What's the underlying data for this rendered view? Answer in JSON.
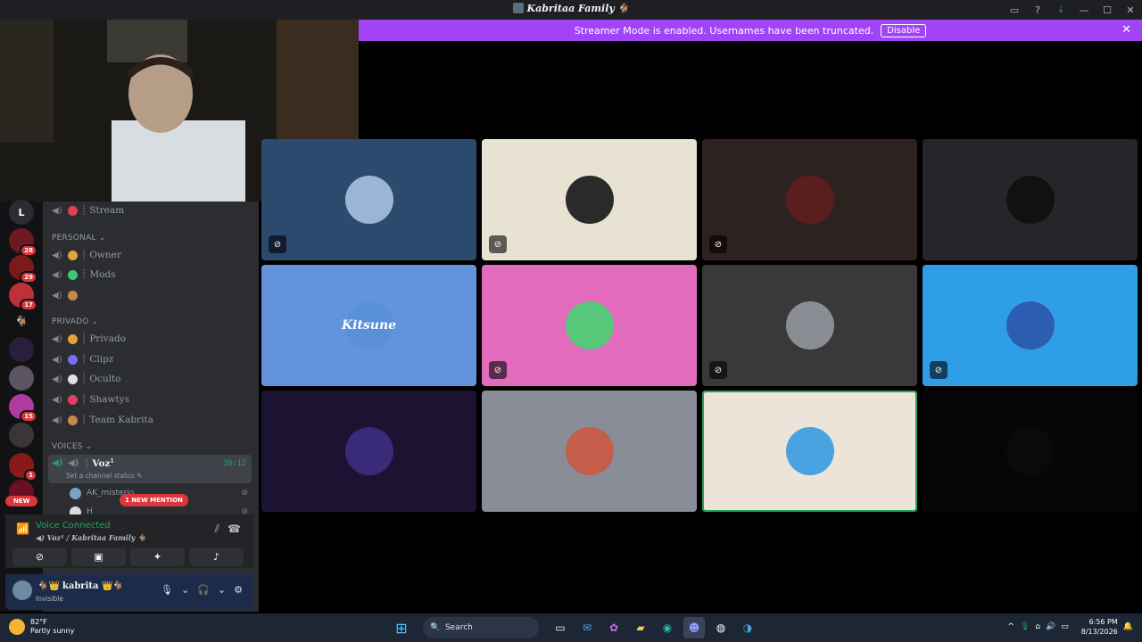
{
  "window": {
    "title": "Kabritaa Family",
    "title_emoji": "🐐"
  },
  "banner": {
    "message": "Streamer Mode is enabled. Usernames have been truncated.",
    "button": "Disable"
  },
  "rail": {
    "home_letter": "L",
    "badges": [
      "28",
      "29",
      "17",
      "15",
      "1"
    ],
    "new_label": "NEW"
  },
  "channels": {
    "top": [
      {
        "name": "Stream",
        "emoji_color": "#e0404f"
      }
    ],
    "personal": {
      "label": "PERSONAL",
      "items": [
        {
          "name": "Owner",
          "emoji_color": "#e3a33b"
        },
        {
          "name": "Mods",
          "emoji_color": "#3ec97a"
        },
        {
          "name": "",
          "emoji_color": "#c58a4a"
        }
      ]
    },
    "privado": {
      "label": "PRIVADO",
      "items": [
        {
          "name": "Privado",
          "emoji_color": "#e3a33b"
        },
        {
          "name": "Clipz",
          "emoji_color": "#7c6bf0"
        },
        {
          "name": "Oculto",
          "emoji_color": "#e0e0e0"
        },
        {
          "name": "Shawtys",
          "emoji_color": "#e0405f"
        },
        {
          "name": "Team Kabrita",
          "emoji_color": "#c58a4a"
        }
      ]
    },
    "voices": {
      "label": "VOICES",
      "active": {
        "name": "Voz",
        "sup": "1",
        "timer": "36:12",
        "status": "Set a channel status"
      }
    },
    "users": [
      "AK_misterio",
      "H"
    ],
    "mention": "1 NEW MENTION"
  },
  "voice_panel": {
    "state": "Voice Connected",
    "location": "Voz¹ / Kabritaa Family"
  },
  "user_panel": {
    "name": "kabrita",
    "status": "Invisible"
  },
  "tiles": [
    {
      "bg": "#2c4a6e",
      "av": "#9bb6d4",
      "muted": true,
      "speaking": false
    },
    {
      "bg": "#e8e2d2",
      "av": "#2a2a2a",
      "muted": true,
      "speaking": false
    },
    {
      "bg": "#2e2220",
      "av": "#5a1e1e",
      "muted": true,
      "speaking": false
    },
    {
      "bg": "#26262a",
      "av": "#111111",
      "muted": false,
      "speaking": false
    },
    {
      "bg": "#6194dc",
      "av": "#5a90d8",
      "muted": false,
      "speaking": false,
      "text": "Kitsune"
    },
    {
      "bg": "#e36bbd",
      "av": "#57c87a",
      "muted": true,
      "speaking": false
    },
    {
      "bg": "#3b3839",
      "av": "#8a8d94",
      "muted": true,
      "speaking": false
    },
    {
      "bg": "#2f9ee8",
      "av": "#2d5db0",
      "muted": true,
      "speaking": false
    },
    {
      "bg": "#1c1332",
      "av": "#3a2a7a",
      "muted": false,
      "speaking": false
    },
    {
      "bg": "#888d98",
      "av": "#c45e4a",
      "muted": false,
      "speaking": false
    },
    {
      "bg": "#ece4d8",
      "av": "#4aa3e0",
      "muted": false,
      "speaking": true
    },
    {
      "bg": "#060606",
      "av": "#0a0a0a",
      "muted": false,
      "speaking": false
    }
  ],
  "taskbar": {
    "temp": "82°F",
    "weather": "Partly sunny",
    "search": "Search",
    "time": "6:56 PM",
    "date": "8/13/2026"
  }
}
